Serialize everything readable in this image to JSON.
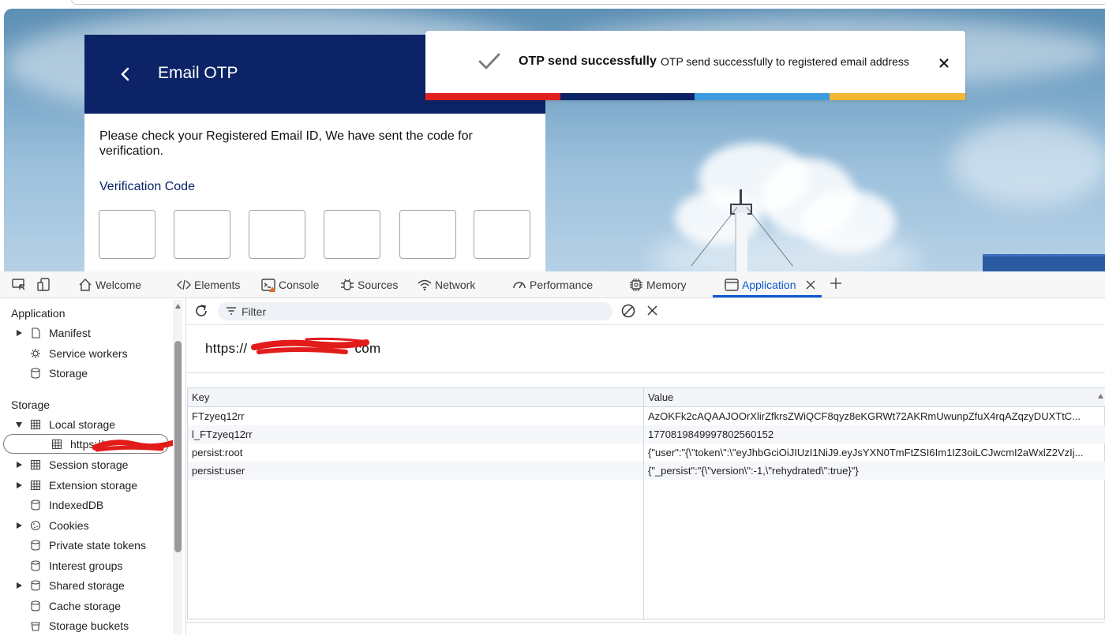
{
  "card": {
    "title": "Email OTP",
    "instruction": "Please check your Registered Email ID, We have sent the code for verification.",
    "code_label": "Verification Code",
    "otp_digits": [
      "",
      "",
      "",
      "",
      "",
      ""
    ]
  },
  "toast": {
    "title": "OTP send successfully",
    "message": "OTP send successfully to registered email address",
    "bar_colors": [
      "#e0201f",
      "#0c2467",
      "#3d9be0",
      "#f2b631"
    ]
  },
  "devtools": {
    "tabs": [
      {
        "label": "Welcome",
        "icon": "home-icon"
      },
      {
        "label": "Elements",
        "icon": "code-icon"
      },
      {
        "label": "Console",
        "icon": "console-icon"
      },
      {
        "label": "Sources",
        "icon": "bug-icon"
      },
      {
        "label": "Network",
        "icon": "wifi-icon"
      },
      {
        "label": "Performance",
        "icon": "gauge-icon"
      },
      {
        "label": "Memory",
        "icon": "chip-icon"
      },
      {
        "label": "Application",
        "icon": "window-icon"
      }
    ],
    "active_tab": "Application",
    "accent": "#0b57d0"
  },
  "sidebar": {
    "application_heading": "Application",
    "application_items": [
      {
        "label": "Manifest",
        "icon": "file-icon",
        "expandable": true
      },
      {
        "label": "Service workers",
        "icon": "gear-icon",
        "expandable": false
      },
      {
        "label": "Storage",
        "icon": "database-icon",
        "expandable": false
      }
    ],
    "storage_heading": "Storage",
    "storage_items": [
      {
        "label": "Local storage",
        "icon": "grid-icon",
        "expandable": true,
        "expanded": true
      },
      {
        "label": "https://",
        "icon": "grid-icon",
        "child": true,
        "selected": true
      },
      {
        "label": "Session storage",
        "icon": "grid-icon",
        "expandable": true
      },
      {
        "label": "Extension storage",
        "icon": "grid-icon",
        "expandable": true
      },
      {
        "label": "IndexedDB",
        "icon": "database-icon",
        "expandable": false
      },
      {
        "label": "Cookies",
        "icon": "cookie-icon",
        "expandable": true
      },
      {
        "label": "Private state tokens",
        "icon": "database-icon",
        "expandable": false
      },
      {
        "label": "Interest groups",
        "icon": "database-icon",
        "expandable": false
      },
      {
        "label": "Shared storage",
        "icon": "database-icon",
        "expandable": true
      },
      {
        "label": "Cache storage",
        "icon": "database-icon",
        "expandable": false
      },
      {
        "label": "Storage buckets",
        "icon": "bucket-icon",
        "expandable": false
      }
    ]
  },
  "main": {
    "filter_placeholder": "Filter",
    "origin_prefix": "https://",
    "origin_suffix": "com",
    "columns": [
      "Key",
      "Value"
    ],
    "rows": [
      {
        "key": "FTzyeq12rr",
        "value": "AzOKFk2cAQAAJOOrXlirZfkrsZWiQCF8qyz8eKGRWt72AKRmUwunpZfuX4rqAZqzyDUXTtC..."
      },
      {
        "key": "l_FTzyeq12rr",
        "value": "1770819849997802560152"
      },
      {
        "key": "persist:root",
        "value": "{\"user\":\"{\\\"token\\\":\\\"eyJhbGciOiJIUzI1NiJ9.eyJsYXN0TmFtZSI6Im1IZ3oiLCJwcmI2aWxlZ2VzIj..."
      },
      {
        "key": "persist:user",
        "value": "{\"_persist\":\"{\\\"version\\\":-1,\\\"rehydrated\\\":true}\"}"
      }
    ]
  }
}
